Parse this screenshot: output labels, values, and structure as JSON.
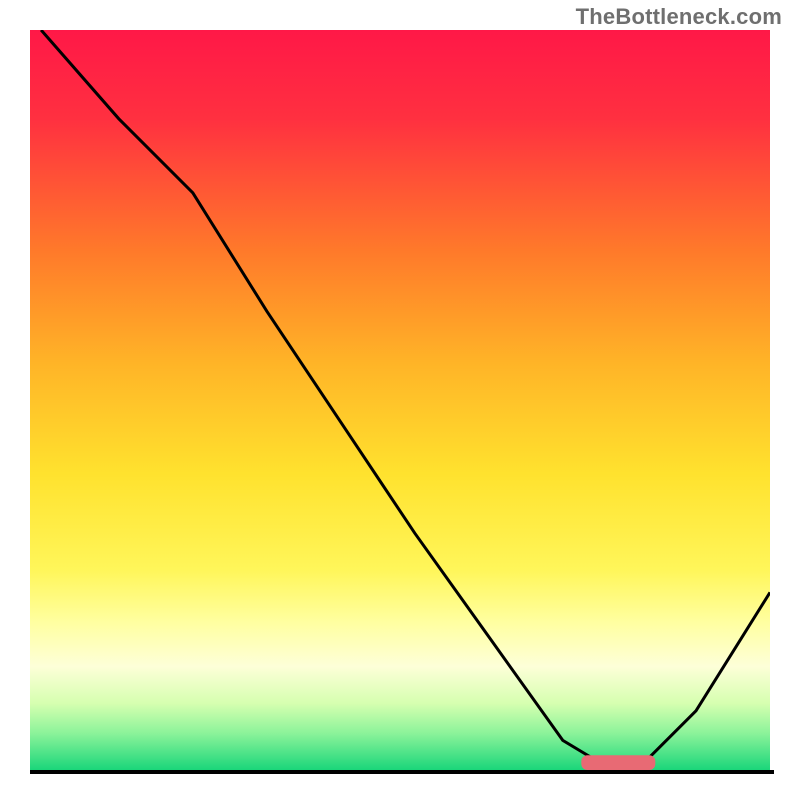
{
  "watermark": "TheBottleneck.com",
  "chart_data": {
    "type": "line",
    "title": "",
    "xlabel": "",
    "ylabel": "",
    "xlim": [
      0,
      100
    ],
    "ylim": [
      0,
      100
    ],
    "grid": false,
    "legend": false,
    "background_gradient": [
      {
        "offset": 0.0,
        "color": "#ff1847"
      },
      {
        "offset": 0.12,
        "color": "#ff3040"
      },
      {
        "offset": 0.3,
        "color": "#ff7a2a"
      },
      {
        "offset": 0.45,
        "color": "#ffb427"
      },
      {
        "offset": 0.6,
        "color": "#ffe22e"
      },
      {
        "offset": 0.73,
        "color": "#fff65a"
      },
      {
        "offset": 0.8,
        "color": "#ffffa0"
      },
      {
        "offset": 0.86,
        "color": "#fdffd8"
      },
      {
        "offset": 0.91,
        "color": "#d6ffb0"
      },
      {
        "offset": 0.95,
        "color": "#8cf39a"
      },
      {
        "offset": 1.0,
        "color": "#1ad67a"
      }
    ],
    "series": [
      {
        "name": "bottleneck-curve",
        "x": [
          1.5,
          12,
          22,
          32,
          42,
          52,
          62,
          72,
          77,
          83,
          90,
          100
        ],
        "y": [
          100,
          88,
          78,
          62,
          47,
          32,
          18,
          4,
          1,
          1,
          8,
          24
        ]
      }
    ],
    "marker": {
      "name": "optimal-range",
      "x_range": [
        74.5,
        84.5
      ],
      "y": 1,
      "height": 2,
      "color": "#e86a74"
    }
  }
}
